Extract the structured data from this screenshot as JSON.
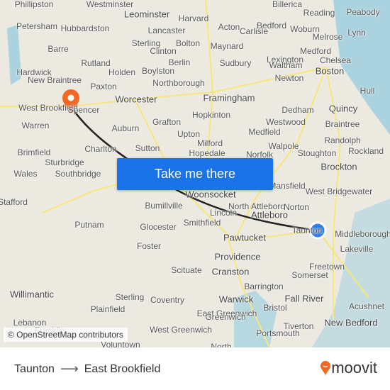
{
  "map": {
    "labels": [
      "Phillipston",
      "Westminster",
      "Leominster",
      "Harvard",
      "Carlisle",
      "Billerica",
      "Reading",
      "Peabody",
      "Petersham",
      "Hubbardston",
      "Lancaster",
      "Acton",
      "Bedford",
      "Woburn",
      "Melrose",
      "Lynn",
      "Barre",
      "Sterling",
      "Clinton",
      "Bolton",
      "Maynard",
      "Lexington",
      "Medford",
      "Rutland",
      "Hardwick",
      "Holden",
      "Boylston",
      "Berlin",
      "Sudbury",
      "Waltham",
      "Chelsea",
      "Boston",
      "New Braintree",
      "Paxton",
      "Northborough",
      "Newton",
      "Hull",
      "West Brookfield",
      "Spencer",
      "Worcester",
      "Framingham",
      "Dedham",
      "Quincy",
      "Warren",
      "Auburn",
      "Grafton",
      "Hopkinton",
      "Westwood",
      "Braintree",
      "Upton",
      "Medfield",
      "Randolph",
      "Brimfield",
      "Charlton",
      "Sutton",
      "Milford",
      "Walpole",
      "Stoughton",
      "Rockland",
      "Sturbridge",
      "Hopedale",
      "Norfolk",
      "Wales",
      "Southbridge",
      "Brockton",
      "Woonsocket",
      "Mansfield",
      "West Bridgewater",
      "Stafford",
      "Bumillville",
      "Lincoln",
      "North Attleboro",
      "Attleboro",
      "Norton",
      "Putnam",
      "Glocester",
      "Smithfield",
      "Middleborough",
      "Taunton",
      "Foster",
      "Pawtucket",
      "Lakeville",
      "Providence",
      "Freetown",
      "Scituate",
      "Cranston",
      "Somerset",
      "Willimantic",
      "Sterling",
      "Coventry",
      "Barrington",
      "Fall River",
      "Acushnet",
      "Plainfield",
      "Warwick",
      "East Greenwich",
      "Bristol",
      "New Bedford",
      "Lebanon",
      "West Greenwich",
      "Tiverton",
      "Portsmouth",
      "Franklin",
      "Voluntown",
      "Greenwich",
      "North"
    ],
    "colors": {
      "water": "#aad3df",
      "road": "#f7e67a",
      "land": "#ece9e1",
      "route": "#222222",
      "origin_pin": "#f26722",
      "destination_dot": "#2f80ed"
    },
    "origin_icon": "map-pin-icon",
    "destination_icon": "location-dot-icon"
  },
  "cta": {
    "label": "Take me there"
  },
  "attribution": "© OpenStreetMap contributors",
  "footer": {
    "from": "Taunton",
    "to": "East Brookfield",
    "arrow_icon": "arrow-right-icon",
    "brand": "moovit",
    "brand_icon": "moovit-pin-icon"
  }
}
